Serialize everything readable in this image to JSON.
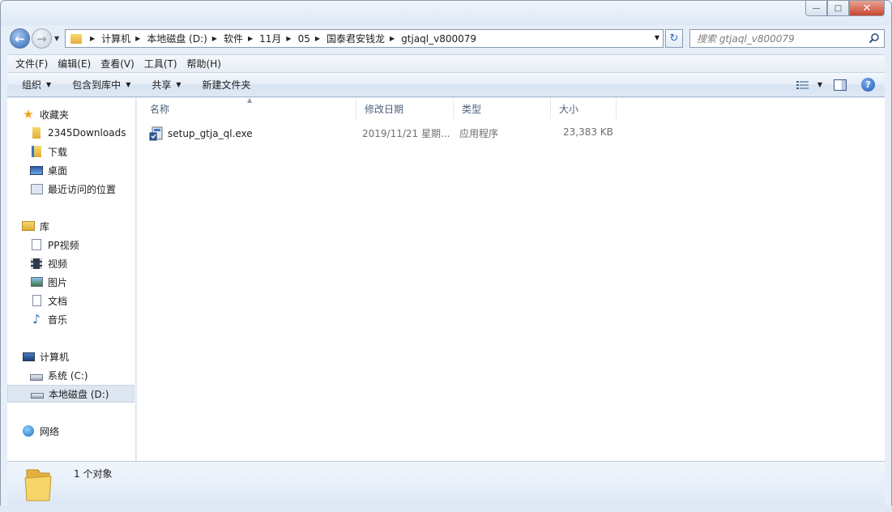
{
  "window": {
    "title": "",
    "buttons": {
      "minimize": "—",
      "maximize": "□",
      "close": "✕"
    }
  },
  "navigation": {
    "back_icon": "back-arrow-icon",
    "forward_icon": "forward-arrow-icon"
  },
  "address": {
    "crumbs": [
      "计算机",
      "本地磁盘 (D:)",
      "软件",
      "11月",
      "05",
      "国泰君安钱龙",
      "gtjaql_v800079"
    ]
  },
  "search": {
    "placeholder": "搜索 gtjaql_v800079"
  },
  "menu": {
    "items": [
      "文件(F)",
      "编辑(E)",
      "查看(V)",
      "工具(T)",
      "帮助(H)"
    ]
  },
  "toolbar": {
    "organize": "组织",
    "include_in_library": "包含到库中",
    "share": "共享",
    "new_folder": "新建文件夹"
  },
  "sidebar": {
    "favorites": {
      "label": "收藏夹",
      "items": [
        "2345Downloads",
        "下载",
        "桌面",
        "最近访问的位置"
      ]
    },
    "libraries": {
      "label": "库",
      "items": [
        "PP视频",
        "视频",
        "图片",
        "文档",
        "音乐"
      ]
    },
    "computer": {
      "label": "计算机",
      "items": [
        "系统 (C:)",
        "本地磁盘 (D:)"
      ],
      "selected": "本地磁盘 (D:)"
    },
    "network": {
      "label": "网络"
    }
  },
  "columns": {
    "name": "名称",
    "date": "修改日期",
    "type": "类型",
    "size": "大小"
  },
  "files": [
    {
      "name": "setup_gtja_ql.exe",
      "date": "2019/11/21 星期...",
      "type": "应用程序",
      "size": "23,383 KB"
    }
  ],
  "status": {
    "count_text": "1 个对象"
  },
  "colors": {
    "accent": "#2b66b6",
    "frame": "#e6eef8",
    "selection": "#dde6f1"
  }
}
